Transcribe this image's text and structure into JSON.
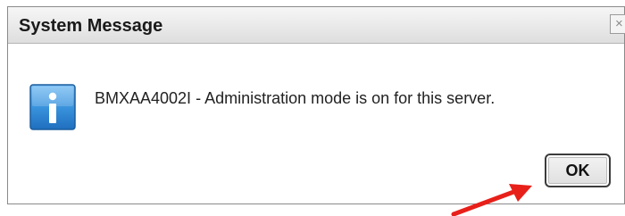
{
  "dialog": {
    "title": "System Message",
    "close_glyph": "×",
    "message": "BMXAA4002I - Administration mode is on for this server.",
    "icon": "info-icon",
    "ok_label": "OK"
  },
  "annotation": {
    "arrow_color": "#e8201a",
    "points_to": "ok-button"
  },
  "colors": {
    "icon_blue": "#2b84d6",
    "icon_blue_light": "#6fb6f0",
    "title_bar": "#e9e9e9"
  }
}
